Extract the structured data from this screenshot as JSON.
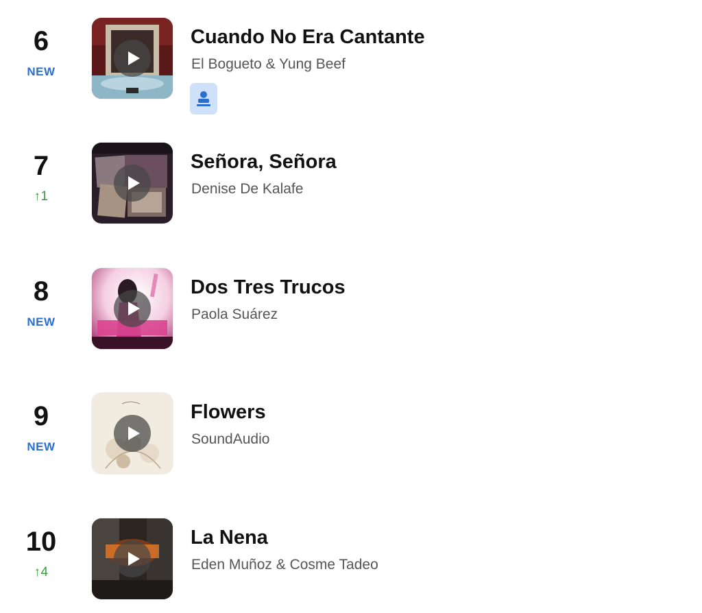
{
  "chart": {
    "entries": [
      {
        "rank": "6",
        "status": "NEW",
        "status_type": "new",
        "title": "Cuando No Era Cantante",
        "artist": "El Bogueto & Yung Beef",
        "badge_icon": "user-badge-icon",
        "art_palette": [
          "#6b1c1c",
          "#c7b9a6",
          "#3d2a28",
          "#8fb8c8"
        ]
      },
      {
        "rank": "7",
        "status": "↑1",
        "status_type": "up",
        "title": "Señora, Señora",
        "artist": "Denise De Kalafe",
        "art_palette": [
          "#3a2a35",
          "#7d5a6a",
          "#b39a8e",
          "#1e1a1d"
        ]
      },
      {
        "rank": "8",
        "status": "NEW",
        "status_type": "new",
        "title": "Dos Tres Trucos",
        "artist": "Paola Suárez",
        "art_palette": [
          "#f6d4e4",
          "#c23a86",
          "#5a1f3a",
          "#ffe6f1"
        ]
      },
      {
        "rank": "9",
        "status": "NEW",
        "status_type": "new",
        "title": "Flowers",
        "artist": "SoundAudio",
        "art_palette": [
          "#f3ece2",
          "#d8c9b3",
          "#b7a488",
          "#efe6d8"
        ]
      },
      {
        "rank": "10",
        "status": "↑4",
        "status_type": "up",
        "title": "La Nena",
        "artist": "Eden Muñoz & Cosme Tadeo",
        "art_palette": [
          "#2b2522",
          "#7a3b1c",
          "#e07a2a",
          "#5b5550"
        ]
      }
    ]
  },
  "colors": {
    "new_status": "#2a6fcf",
    "up_status": "#3b9b3b",
    "title": "#111111",
    "artist": "#555555",
    "badge_bg": "#cfe0fb",
    "badge_icon": "#2a6fcf"
  },
  "icons": {
    "play": "play-icon",
    "badge": "user-badge-icon"
  }
}
